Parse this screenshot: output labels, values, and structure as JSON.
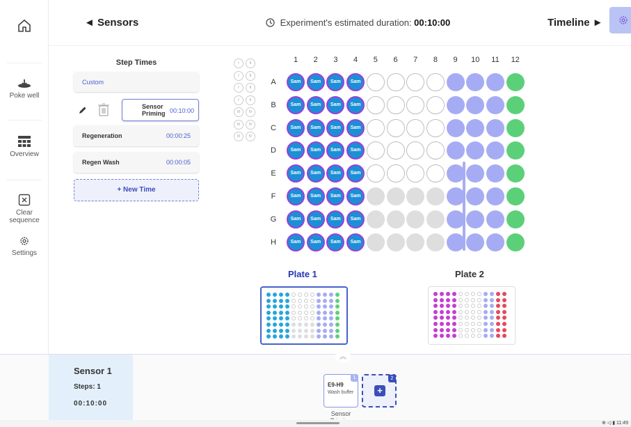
{
  "header": {
    "back_label": "◄ Sensors",
    "duration_label": "Experiment's estimated duration:",
    "duration_value": "00:10:00",
    "timeline_label": "Timeline ►"
  },
  "sidebar": {
    "home_icon": "home-icon",
    "poke_well": "Poke well",
    "overview": "Overview",
    "clear_sequence": "Clear sequence",
    "settings": "Settings"
  },
  "step_times": {
    "title": "Step Times",
    "custom": "Custom",
    "items": [
      {
        "label": "Sensor Priming",
        "value": "00:10:00"
      },
      {
        "label": "Regeneration",
        "value": "00:00:25"
      },
      {
        "label": "Regen Wash",
        "value": "00:00:05"
      }
    ],
    "new_time": "+ New Time"
  },
  "grid": {
    "columns": [
      "1",
      "2",
      "3",
      "4",
      "5",
      "6",
      "7",
      "8",
      "9",
      "10",
      "11",
      "12"
    ],
    "rows": [
      "A",
      "B",
      "C",
      "D",
      "E",
      "F",
      "G",
      "H"
    ],
    "sample_text": "Sam",
    "roman": [
      [
        "I",
        "II"
      ],
      [
        "I",
        "II"
      ],
      [
        "I",
        "II"
      ],
      [
        "I",
        "II"
      ],
      [
        "III",
        "IV"
      ],
      [
        "III",
        "IV"
      ],
      [
        "III",
        "IV"
      ]
    ]
  },
  "plates": {
    "plate1": "Plate 1",
    "plate2": "Plate 2"
  },
  "sensor": {
    "title": "Sensor 1",
    "steps": "Steps: 1",
    "duration": "00:10:00"
  },
  "sequence": {
    "card1_badge": "1",
    "card1_id": "E9-H9",
    "card1_type": "Wash buffer",
    "card2_badge": "2",
    "card1_name": "Sensor Priming"
  },
  "system": {
    "time": "11:49"
  },
  "colors": {
    "sample_fill": "#1d8fd6",
    "sample_ring": "#9a3fd8",
    "purple": "#a6acf3",
    "green": "#5cd079",
    "grey": "#dedede",
    "accent": "#3a4fb6"
  }
}
